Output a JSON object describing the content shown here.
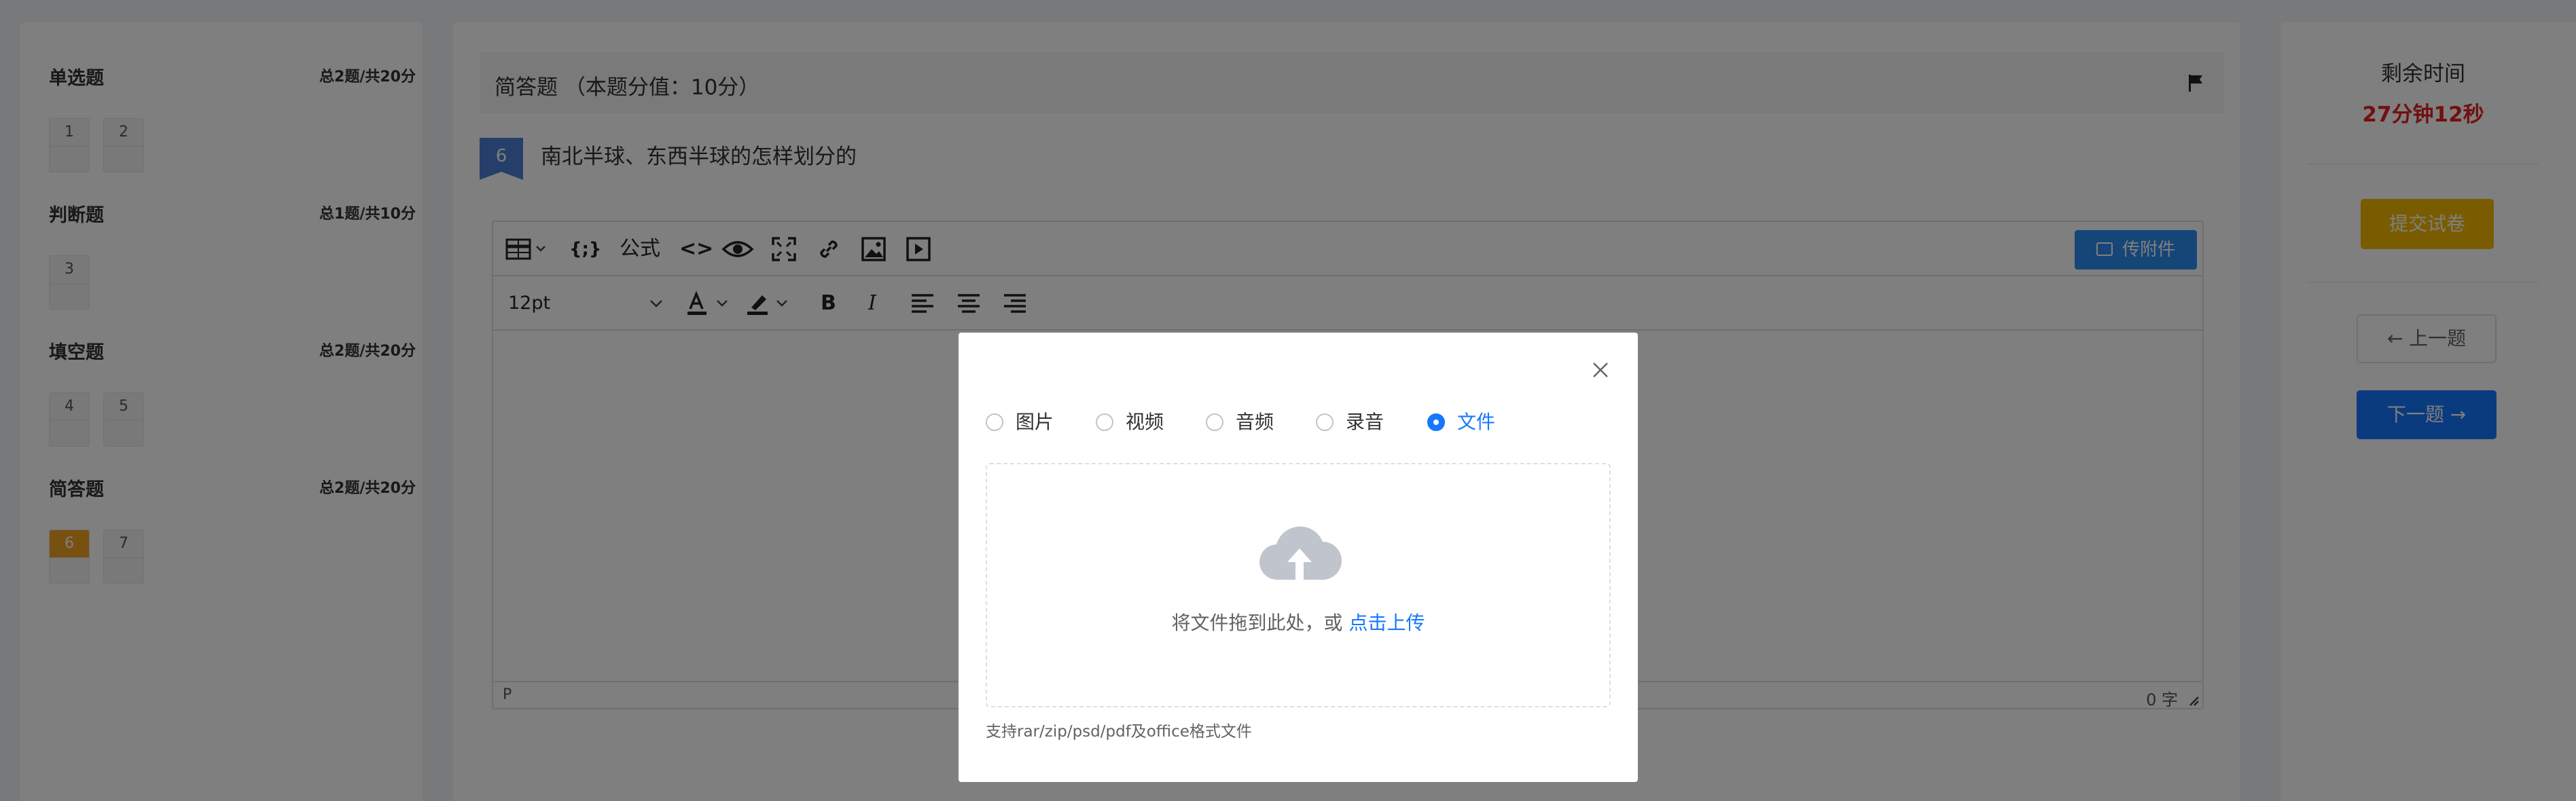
{
  "sidebar": {
    "sections": [
      {
        "title": "单选题",
        "total": "总2题/共20分",
        "questions": [
          "1",
          "2"
        ]
      },
      {
        "title": "判断题",
        "total": "总1题/共10分",
        "questions": [
          "3"
        ]
      },
      {
        "title": "填空题",
        "total": "总2题/共20分",
        "questions": [
          "4",
          "5"
        ]
      },
      {
        "title": "简答题",
        "total": "总2题/共20分",
        "questions": [
          "6",
          "7"
        ]
      }
    ]
  },
  "question": {
    "header": "简答题 （本题分值：10分）",
    "number": "6",
    "text": "南北半球、东西半球的怎样划分的"
  },
  "editor": {
    "formula_label": "公式",
    "font_size": "12pt",
    "attach_label": "传附件",
    "status_path": "P",
    "word_count": "0 字"
  },
  "timer": {
    "label": "剩余时间",
    "value": "27分钟12秒"
  },
  "actions": {
    "submit": "提交试卷",
    "prev": "← 上一题",
    "next": "下一题 →"
  },
  "upload_modal": {
    "types": [
      "图片",
      "视频",
      "音频",
      "录音",
      "文件"
    ],
    "selected": "文件",
    "drop_text": "将文件拖到此处，或",
    "drop_link": "点击上传",
    "tip": "支持rar/zip/psd/pdf及office格式文件"
  },
  "colors": {
    "primary": "#1677ff",
    "warning": "#f5b800",
    "danger": "#e52020",
    "active_question": "#f0a020"
  }
}
